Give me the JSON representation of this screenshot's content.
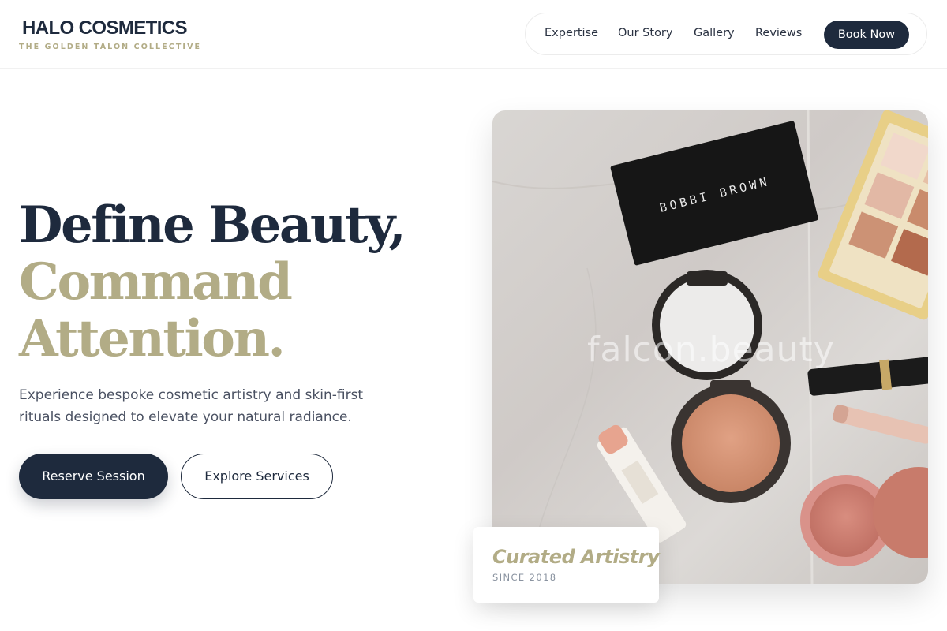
{
  "brand": {
    "name": "HALO COSMETICS",
    "tagline": "THE GOLDEN TALON COLLECTIVE"
  },
  "nav": {
    "items": [
      {
        "label": "Expertise"
      },
      {
        "label": "Our Story"
      },
      {
        "label": "Gallery"
      },
      {
        "label": "Reviews"
      }
    ],
    "cta": "Book Now"
  },
  "hero": {
    "headline_line1": "Define Beauty,",
    "headline_line2": "Command",
    "headline_line3": "Attention.",
    "subtext": "Experience bespoke cosmetic artistry and skin-first rituals designed to elevate your natural radiance.",
    "primary_button": "Reserve Session",
    "secondary_button": "Explore Services"
  },
  "image": {
    "box_label": "BOBBI BROWN",
    "watermark": "falcon.beauty"
  },
  "badge": {
    "title": "Curated Artistry",
    "subtitle": "SINCE 2018"
  },
  "colors": {
    "navy": "#1e2a3d",
    "gold": "#b2ac86",
    "body_text": "#4a5162"
  }
}
